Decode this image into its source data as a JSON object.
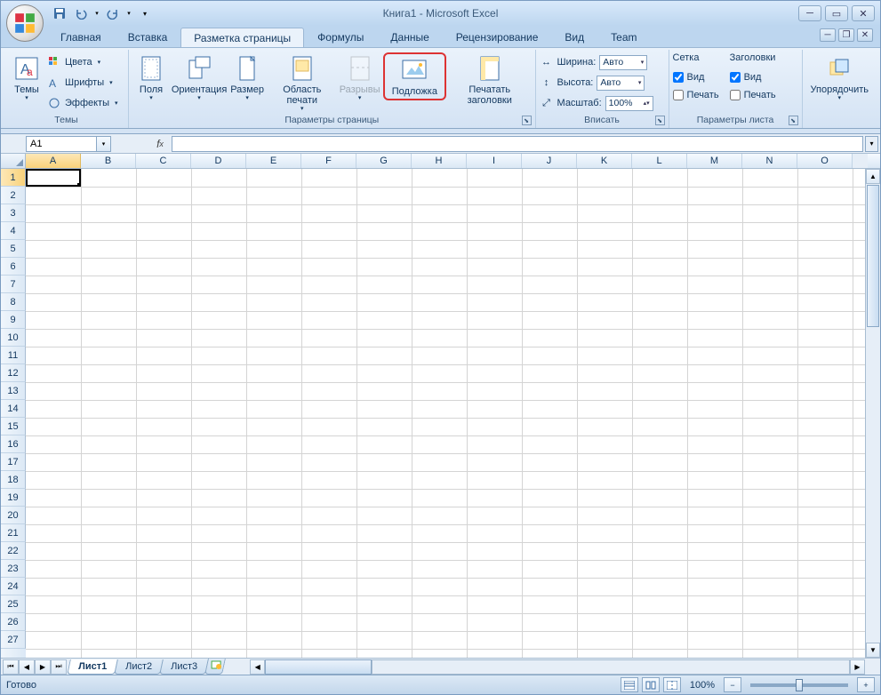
{
  "title": "Книга1 - Microsoft Excel",
  "tabs": [
    "Главная",
    "Вставка",
    "Разметка страницы",
    "Формулы",
    "Данные",
    "Рецензирование",
    "Вид",
    "Team"
  ],
  "active_tab_index": 2,
  "ribbon": {
    "themes": {
      "label": "Темы",
      "btn": "Темы",
      "colors": "Цвета",
      "fonts": "Шрифты",
      "effects": "Эффекты"
    },
    "page_setup": {
      "label": "Параметры страницы",
      "margins": "Поля",
      "orientation": "Ориентация",
      "size": "Размер",
      "print_area": "Область печати",
      "breaks": "Разрывы",
      "background": "Подложка",
      "print_titles": "Печатать заголовки"
    },
    "scale": {
      "label": "Вписать",
      "width_lbl": "Ширина:",
      "height_lbl": "Высота:",
      "scale_lbl": "Масштаб:",
      "auto": "Авто",
      "scale_val": "100%"
    },
    "sheet_opts": {
      "label": "Параметры листа",
      "grid_hdr": "Сетка",
      "head_hdr": "Заголовки",
      "view": "Вид",
      "print": "Печать"
    },
    "arrange": {
      "label": "",
      "btn": "Упорядочить"
    }
  },
  "namebox": "A1",
  "columns": [
    "A",
    "B",
    "C",
    "D",
    "E",
    "F",
    "G",
    "H",
    "I",
    "J",
    "K",
    "L",
    "M",
    "N",
    "O"
  ],
  "rows": [
    1,
    2,
    3,
    4,
    5,
    6,
    7,
    8,
    9,
    10,
    11,
    12,
    13,
    14,
    15,
    16,
    17,
    18,
    19,
    20,
    21,
    22,
    23,
    24,
    25,
    26,
    27
  ],
  "sheets": [
    "Лист1",
    "Лист2",
    "Лист3"
  ],
  "active_sheet_index": 0,
  "status": {
    "ready": "Готово",
    "zoom": "100%"
  }
}
